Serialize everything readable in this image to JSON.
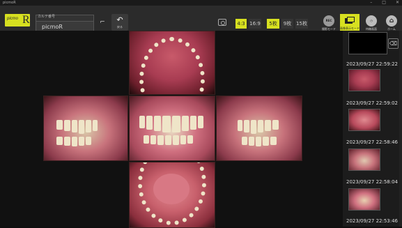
{
  "app": {
    "window_title": "picmoR",
    "logo_text": "picmo",
    "logo_letter": "R"
  },
  "patient": {
    "id_label": "カルテ番号",
    "id_value": "picmoR"
  },
  "toolbar": {
    "back_label": "戻る",
    "aspect": [
      {
        "label": "4:3",
        "selected": true
      },
      {
        "label": "16:9",
        "selected": false
      }
    ],
    "count": [
      {
        "label": "5枚",
        "selected": true
      },
      {
        "label": "9枚",
        "selected": false
      },
      {
        "label": "15枚",
        "selected": false
      }
    ],
    "modes": [
      {
        "label": "撮影モード",
        "icon": "rec-icon",
        "icon_text": "REC"
      },
      {
        "label": "画像表示モード",
        "icon": "gallery-icon",
        "selected": true
      },
      {
        "label": "待機画面",
        "icon": "clock-icon"
      },
      {
        "label": "ホーム",
        "icon": "home-icon"
      }
    ]
  },
  "thumbnails": [
    {
      "timestamp": "2023/09/27 22:59:22",
      "kind": "blank"
    },
    {
      "timestamp": "2023/09/27 22:59:02",
      "kind": "upper"
    },
    {
      "timestamp": "2023/09/27 22:58:46",
      "kind": "lower"
    },
    {
      "timestamp": "2023/09/27 22:58:04",
      "kind": "side"
    },
    {
      "timestamp": "2023/09/27 22:53:46",
      "kind": "front"
    }
  ],
  "colors": {
    "accent": "#d7e020",
    "toolbar_bg": "#2b2b2b",
    "workspace_bg": "#111111"
  }
}
